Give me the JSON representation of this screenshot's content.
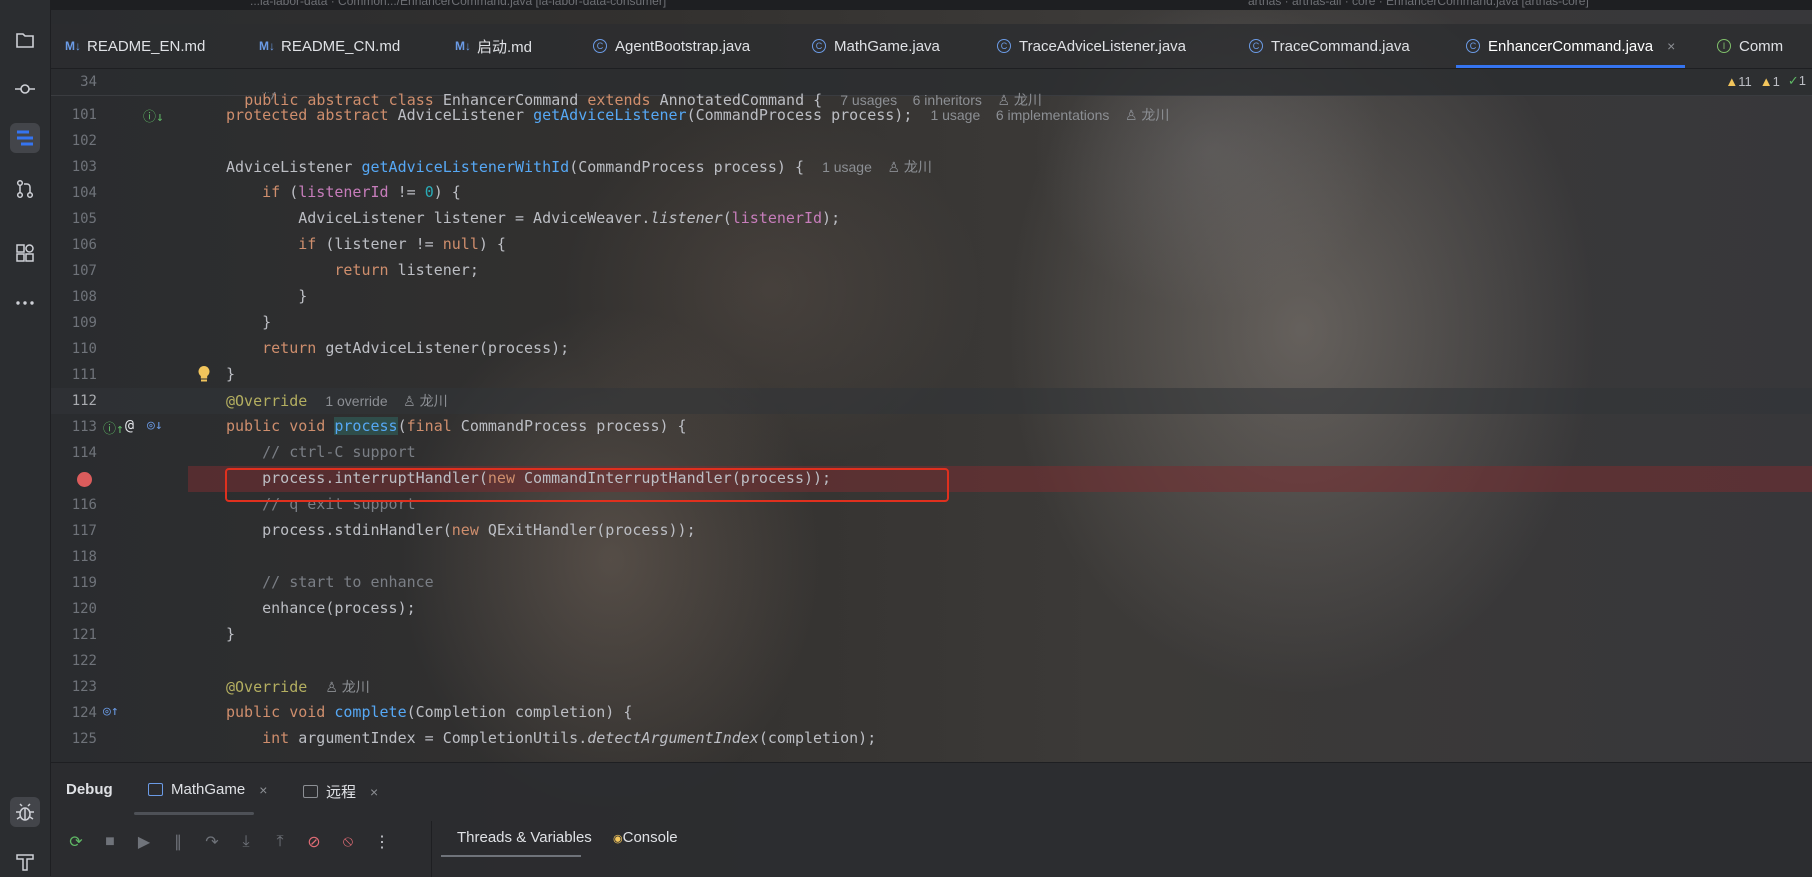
{
  "window": {
    "path_left": "...la-labor-data · Common.../EnhancerCommand.java [la-labor-data-consumer]",
    "path_right": "arthas · arthas-all · core · EnhancerCommand.java [arthas-core]"
  },
  "tool_strip": [
    {
      "name": "project-icon"
    },
    {
      "name": "commit-icon"
    },
    {
      "name": "structure-icon"
    },
    {
      "name": "pull-requests-icon"
    },
    {
      "name": "plugins-icon"
    },
    {
      "name": "more-icon"
    }
  ],
  "tabs": [
    {
      "label": "README_EN.md",
      "icon": "M↓"
    },
    {
      "label": "README_CN.md",
      "icon": "M↓"
    },
    {
      "label": "启动.md",
      "icon": "M↓"
    },
    {
      "label": "AgentBootstrap.java",
      "icon": "C"
    },
    {
      "label": "MathGame.java",
      "icon": "C"
    },
    {
      "label": "TraceAdviceListener.java",
      "icon": "C"
    },
    {
      "label": "TraceCommand.java",
      "icon": "C"
    },
    {
      "label": "EnhancerCommand.java",
      "icon": "C",
      "close": "×"
    },
    {
      "label": "Comm",
      "icon": "I"
    }
  ],
  "inspections": {
    "warnings": "11",
    "weak": "1",
    "ok": "1"
  },
  "editor": {
    "sticky": {
      "line": "34",
      "kw1": "public abstract class",
      "cls": "EnhancerCommand",
      "kw2": "extends",
      "sup": "AnnotatedCommand {",
      "ann": "7 usages    6 inheritors    ♙ 龙川"
    },
    "partial_comment": "*/",
    "lines": {
      "l101": {
        "n": "101",
        "a": "protected abstract",
        "b": " AdviceListener ",
        "c": "getAdviceListener",
        "d": "(CommandProcess process);",
        "ann": "1 usage    6 implementations    ♙ 龙川"
      },
      "l102": {
        "n": "102"
      },
      "l103": {
        "n": "103",
        "a": "AdviceListener ",
        "b": "getAdviceListenerWithId",
        "c": "(CommandProcess process) {",
        "ann": "1 usage    ♙ 龙川"
      },
      "l104": {
        "n": "104",
        "a": "if",
        "b": " (",
        "c": "listenerId",
        "d": " != ",
        "e": "0",
        "f": ") {"
      },
      "l105": {
        "n": "105",
        "a": "AdviceListener listener = AdviceWeaver.",
        "b": "listener",
        "c": "(",
        "d": "listenerId",
        "e": ");"
      },
      "l106": {
        "n": "106",
        "a": "if",
        "b": " (listener != ",
        "c": "null",
        "d": ") {"
      },
      "l107": {
        "n": "107",
        "a": "return",
        "b": " listener;"
      },
      "l108": {
        "n": "108",
        "a": "}"
      },
      "l109": {
        "n": "109",
        "a": "}"
      },
      "l110": {
        "n": "110",
        "a": "return",
        "b": " getAdviceListener(process);"
      },
      "l111": {
        "n": "111",
        "a": "}"
      },
      "l112": {
        "n": "112",
        "a": "@Override",
        "ann": "1 override    ♙ 龙川"
      },
      "l113": {
        "n": "113",
        "a": "public void",
        "b": " ",
        "c": "process",
        "d": "(",
        "e": "final",
        "f": " CommandProcess process) {"
      },
      "l114": {
        "n": "114",
        "a": "// ctrl-C support"
      },
      "l115": {
        "a": "process.interruptHandler(",
        "b": "new",
        "c": " CommandInterruptHandler(process));"
      },
      "l116": {
        "n": "116",
        "a": "// q exit support"
      },
      "l117": {
        "n": "117",
        "a": "process.stdinHandler(",
        "b": "new",
        "c": " QExitHandler(process));"
      },
      "l118": {
        "n": "118"
      },
      "l119": {
        "n": "119",
        "a": "// start to enhance"
      },
      "l120": {
        "n": "120",
        "a": "enhance(process);"
      },
      "l121": {
        "n": "121",
        "a": "}"
      },
      "l122": {
        "n": "122"
      },
      "l123": {
        "n": "123",
        "a": "@Override",
        "ann": "♙ 龙川"
      },
      "l124": {
        "n": "124",
        "a": "public void",
        "b": " ",
        "c": "complete",
        "d": "(Completion completion) {"
      },
      "l125": {
        "n": "125",
        "a": "int",
        "b": " argumentIndex = CompletionUtils.",
        "c": "detectArgumentIndex",
        "d": "(completion);"
      }
    }
  },
  "debug": {
    "title": "Debug",
    "tabs": [
      {
        "label": "MathGame",
        "close": "×"
      },
      {
        "label": "远程",
        "close": "×"
      }
    ],
    "subtabs": [
      "Threads & Variables",
      "Console"
    ]
  }
}
